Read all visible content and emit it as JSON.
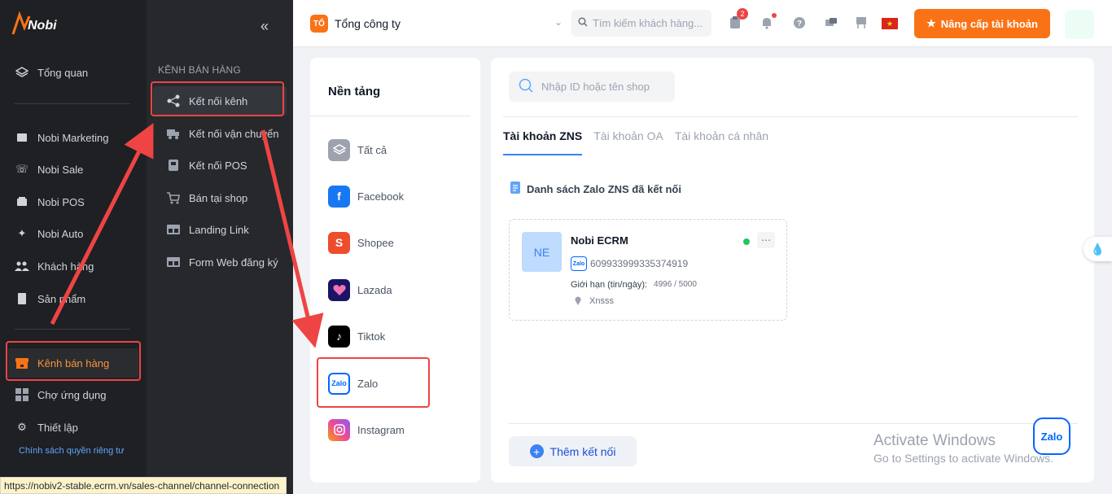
{
  "logo": {
    "text": "Nobi"
  },
  "sidebar": {
    "items": [
      {
        "label": "Tổng quan",
        "icon": "layers-icon"
      },
      {
        "label": "Nobi Marketing",
        "icon": "inbox-icon"
      },
      {
        "label": "Nobi Sale",
        "icon": "phone-icon"
      },
      {
        "label": "Nobi POS",
        "icon": "pos-icon"
      },
      {
        "label": "Nobi Auto",
        "icon": "sparkle-icon"
      },
      {
        "label": "Khách hàng",
        "icon": "users-icon"
      },
      {
        "label": "Sản phẩm",
        "icon": "document-icon"
      },
      {
        "label": "Kênh bán hàng",
        "icon": "store-icon",
        "active": true
      },
      {
        "label": "Chợ ứng dụng",
        "icon": "grid-icon"
      },
      {
        "label": "Thiết lập",
        "icon": "gear-icon"
      }
    ],
    "privacy_link": "Chính sách quyền riêng tư"
  },
  "submenu": {
    "title": "KÊNH BÁN HÀNG",
    "collapse_icon": "double-chevron-left-icon",
    "items": [
      {
        "label": "Kết nối kênh",
        "icon": "share-icon",
        "active": true
      },
      {
        "label": "Kết nối vận chuyển",
        "icon": "truck-icon"
      },
      {
        "label": "Kết nối POS",
        "icon": "pos-terminal-icon"
      },
      {
        "label": "Bán tại shop",
        "icon": "cart-icon"
      },
      {
        "label": "Landing Link",
        "icon": "link-page-icon"
      },
      {
        "label": "Form Web đăng ký",
        "icon": "form-icon"
      }
    ]
  },
  "topbar": {
    "company_badge": "TỔ",
    "company_name": "Tổng công ty",
    "search_placeholder": "Tìm kiếm khách hàng...",
    "task_badge_count": "2",
    "upgrade_label": "Nâng cấp tài khoản"
  },
  "platform": {
    "title": "Nền tảng",
    "items": [
      {
        "label": "Tất cả",
        "icon": "all-icon"
      },
      {
        "label": "Facebook",
        "icon": "facebook-icon"
      },
      {
        "label": "Shopee",
        "icon": "shopee-icon"
      },
      {
        "label": "Lazada",
        "icon": "lazada-icon"
      },
      {
        "label": "Tiktok",
        "icon": "tiktok-icon"
      },
      {
        "label": "Zalo",
        "icon": "zalo-icon"
      },
      {
        "label": "Instagram",
        "icon": "instagram-icon"
      }
    ]
  },
  "main": {
    "search_placeholder": "Nhập ID hoặc tên shop",
    "tabs": [
      {
        "label": "Tài khoản ZNS",
        "active": true
      },
      {
        "label": "Tài khoản OA"
      },
      {
        "label": "Tài khoản cá nhân"
      }
    ],
    "list_title": "Danh sách Zalo ZNS đã kết nối",
    "card": {
      "avatar_text": "NE",
      "name": "Nobi ECRM",
      "zalo_logo_text": "Zalo",
      "id": "609933999335374919",
      "limit_label": "Giới hạn (tin/ngày):",
      "limit_value": "4996 / 5000",
      "location": "Xnsss",
      "status_color": "#22c55e"
    },
    "add_button": "Thêm kết nối"
  },
  "watermark": {
    "line1": "Activate Windows",
    "line2": "Go to Settings to activate Windows."
  },
  "float_zalo": "Zalo",
  "status_url": "https://nobiv2-stable.ecrm.vn/sales-channel/channel-connection",
  "colors": {
    "accent": "#f97316",
    "highlight": "#ef4444",
    "link": "#3b82f6"
  }
}
